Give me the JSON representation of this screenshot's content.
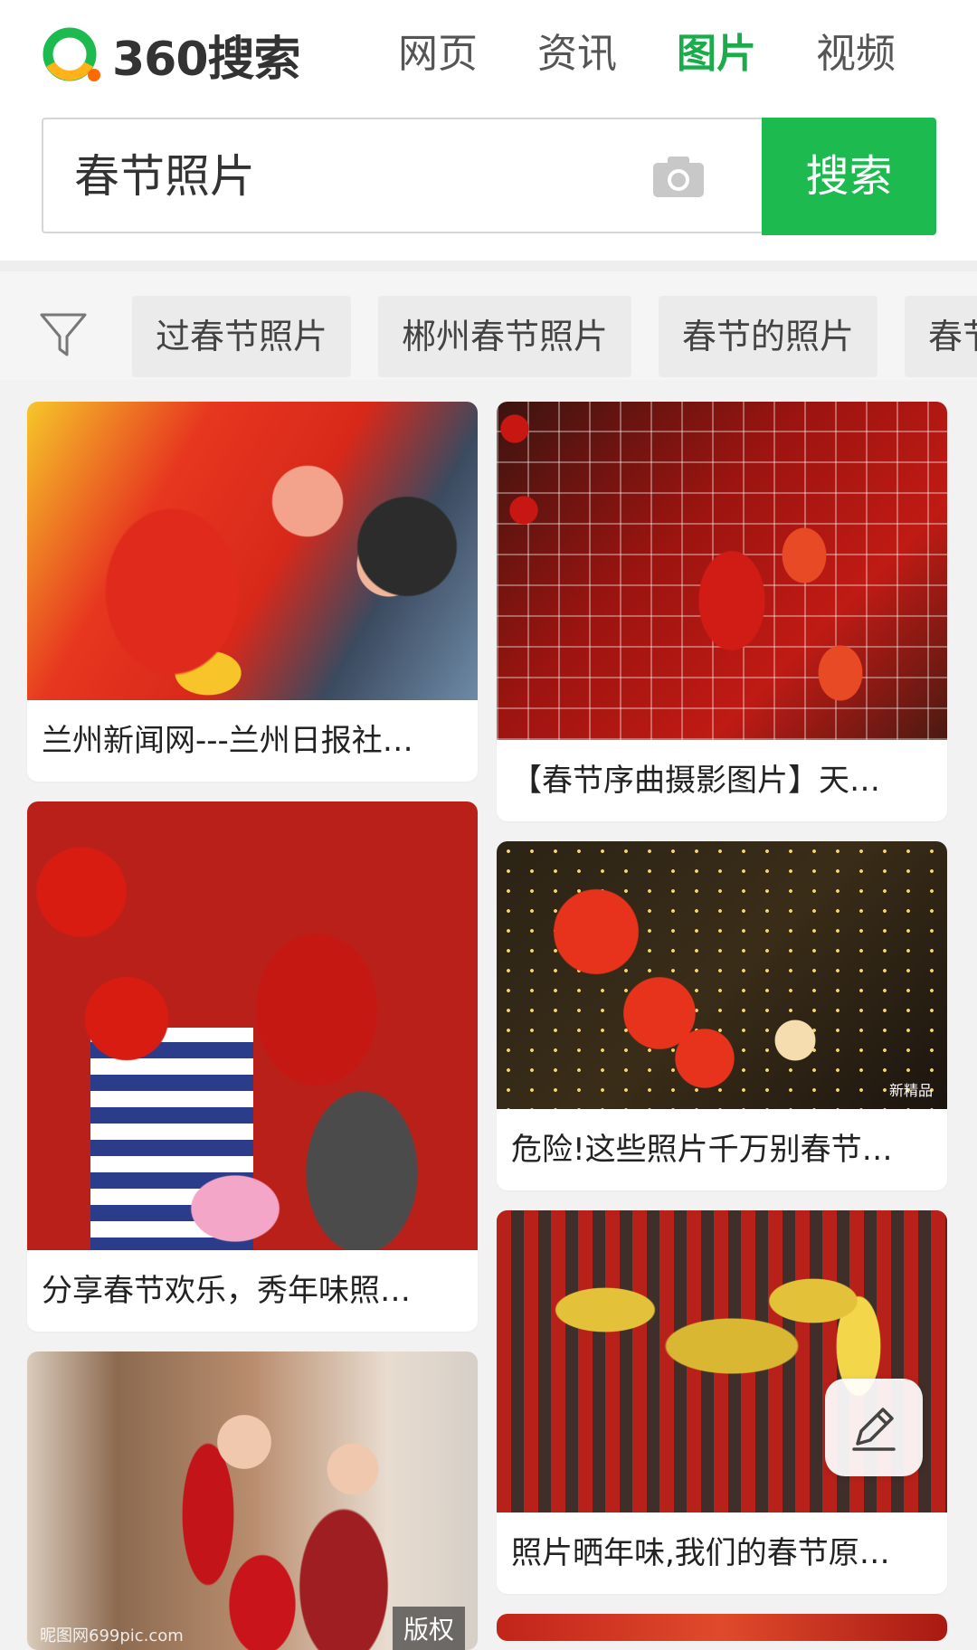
{
  "app": {
    "logo_text": "360搜索",
    "brand_color": "#1dba50",
    "logo_colors": [
      "#1dba50",
      "#ffb21a",
      "#ff6a00"
    ]
  },
  "nav": {
    "tabs": [
      {
        "label": "网页",
        "active": false
      },
      {
        "label": "资讯",
        "active": false
      },
      {
        "label": "图片",
        "active": true
      },
      {
        "label": "视频",
        "active": false
      }
    ]
  },
  "search": {
    "query": "春节照片",
    "button_label": "搜索",
    "camera_icon": "camera-icon"
  },
  "filters": {
    "icon": "filter-icon",
    "chips": [
      "过春节照片",
      "郴州春节照片",
      "春节的照片",
      "春节"
    ]
  },
  "results": {
    "left": [
      {
        "caption": "兰州新闻网---兰州日报社…"
      },
      {
        "caption": "分享春节欢乐，秀年味照…"
      },
      {
        "caption": "",
        "badge": "版权",
        "watermark": "昵图网699pic.com"
      }
    ],
    "right": [
      {
        "caption": "【春节序曲摄影图片】天…"
      },
      {
        "caption": "危险!这些照片千万别春节…",
        "watermark": "新精品"
      },
      {
        "caption": "照片晒年味,我们的春节原…"
      }
    ]
  },
  "floating_button": {
    "icon": "edit-icon"
  }
}
